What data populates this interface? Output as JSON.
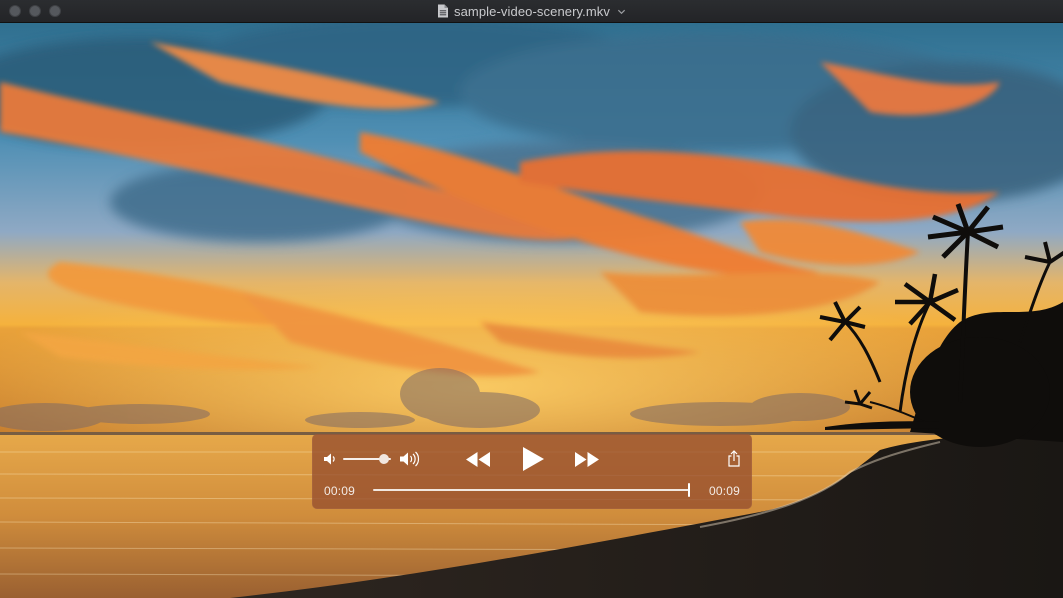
{
  "window": {
    "title": "sample-video-scenery.mkv",
    "title_icon": "document-icon",
    "traffic_lights": [
      "close-button",
      "minimize-button",
      "zoom-button"
    ]
  },
  "player": {
    "elapsed_time": "00:09",
    "remaining_time": "00:09",
    "playback_progress": 1.0,
    "volume_level": 0.85,
    "state": "paused",
    "controls": [
      "volume-low-icon",
      "volume-slider",
      "volume-high-icon",
      "rewind-button",
      "play-button",
      "fast-forward-button",
      "share-button",
      "scrubber"
    ]
  },
  "colors": {
    "hud_background": "#964e2e",
    "titlebar": "#2b2d30",
    "control_foreground": "#ffffff"
  }
}
